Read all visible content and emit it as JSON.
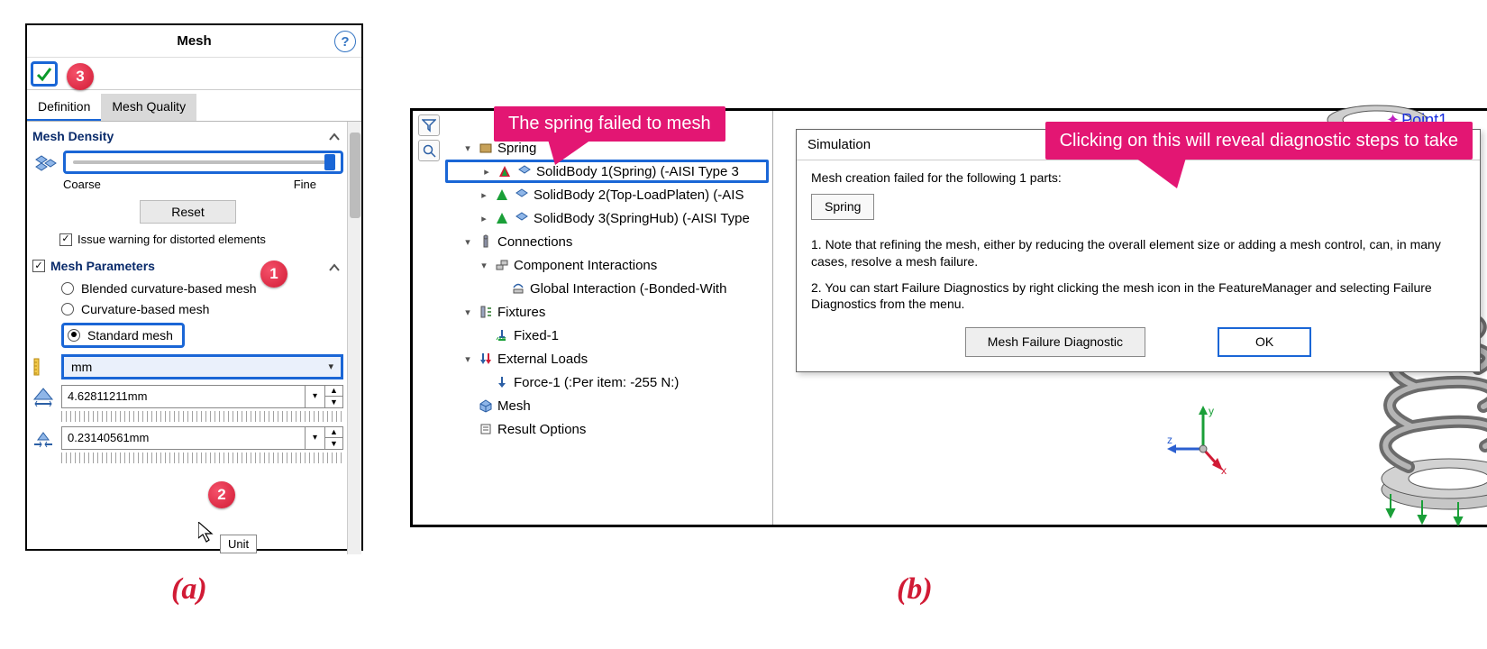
{
  "panel_a": {
    "title": "Mesh",
    "tabs": {
      "active": "Definition",
      "inactive": "Mesh Quality"
    },
    "density": {
      "heading": "Mesh Density",
      "coarse": "Coarse",
      "fine": "Fine",
      "reset": "Reset",
      "warn": "Issue warning for distorted elements"
    },
    "params": {
      "heading": "Mesh Parameters",
      "radios": {
        "r1": "Blended curvature-based mesh",
        "r2": "Curvature-based mesh",
        "r3": "Standard mesh"
      },
      "unit_value": "mm",
      "size_value": "4.62811211mm",
      "tol_value": "0.23140561mm",
      "tooltip": "Unit"
    },
    "badges": {
      "one": "1",
      "two": "2",
      "three": "3"
    }
  },
  "panel_b": {
    "tree": {
      "spring_group": "Spring",
      "body1": "SolidBody 1(Spring) (-AISI Type 3",
      "body2": "SolidBody 2(Top-LoadPlaten) (-AIS",
      "body3": "SolidBody 3(SpringHub) (-AISI Type",
      "connections": "Connections",
      "comp_int": "Component Interactions",
      "global_int": "Global Interaction (-Bonded-With",
      "fixtures": "Fixtures",
      "fixed1": "Fixed-1",
      "ext_loads": "External Loads",
      "force1": "Force-1 (:Per item: -255 N:)",
      "mesh": "Mesh",
      "result_opts": "Result Options"
    },
    "dialog": {
      "title": "Simulation",
      "msg1": "Mesh creation failed for the following 1 parts:",
      "part": "Spring",
      "note1": "1. Note that refining the mesh, either by reducing the overall element size or adding a mesh control, can, in many cases, resolve a mesh failure.",
      "note2": "2. You can start Failure Diagnostics by right clicking the mesh icon in the FeatureManager and selecting Failure Diagnostics from the menu.",
      "btn_diag": "Mesh Failure Diagnostic",
      "btn_ok": "OK"
    },
    "point_label": "Point1",
    "callouts": {
      "a": "The spring failed to mesh",
      "b": "Clicking on this will reveal diagnostic steps to take"
    }
  },
  "figlabels": {
    "a": "(a)",
    "b": "(b)"
  }
}
